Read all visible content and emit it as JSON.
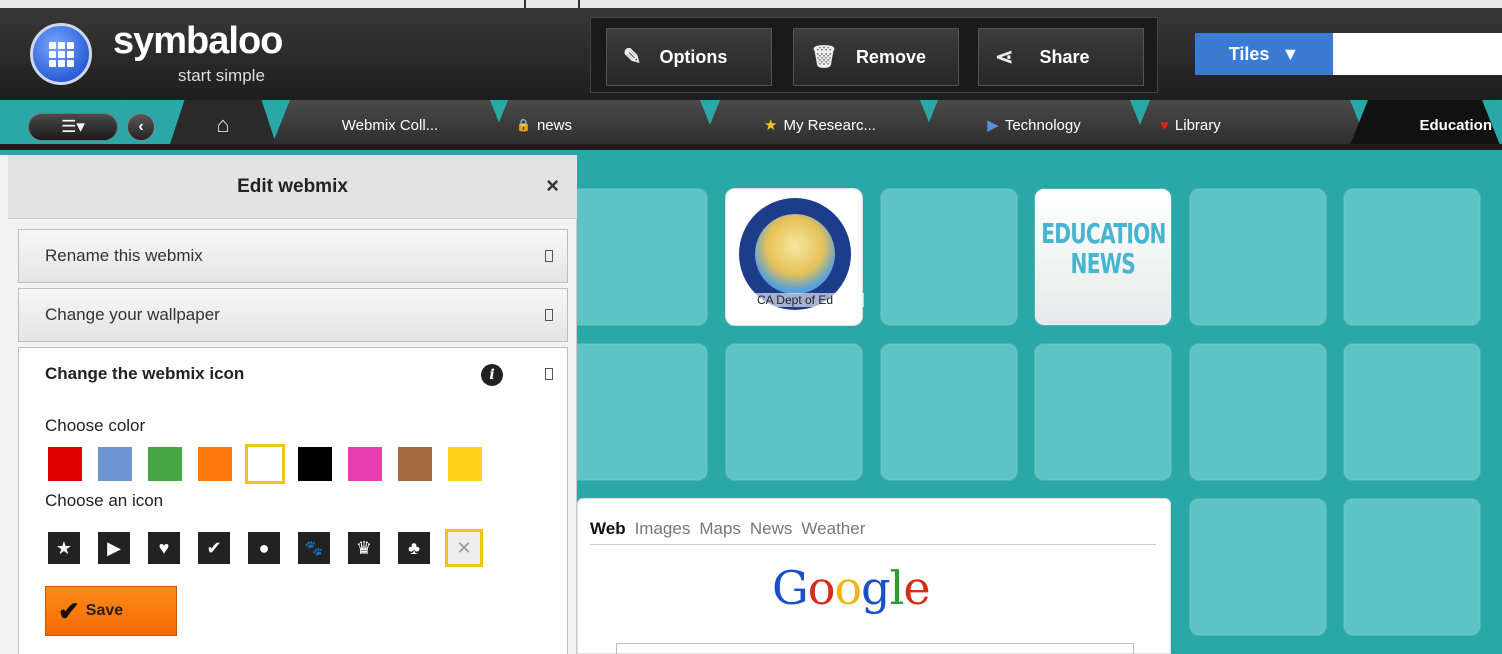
{
  "brand": {
    "name": "symbaloo",
    "tagline": "start simple"
  },
  "toolbar": {
    "options_label": "Options",
    "remove_label": "Remove",
    "share_label": "Share",
    "tiles_label": "Tiles",
    "tiles_arrow": "▼"
  },
  "tabs": {
    "menu_icon": "☰▾",
    "back_icon": "‹",
    "home_icon": "⌂",
    "items": [
      {
        "label": "Webmix Coll...",
        "icon": ""
      },
      {
        "label": "news",
        "icon": "🔒",
        "icon_name": "lock-icon"
      },
      {
        "label": "My Researc...",
        "icon": "★",
        "icon_name": "star-icon",
        "icon_color": "#f5c518"
      },
      {
        "label": "Technology",
        "icon": "▶",
        "icon_name": "play-icon",
        "icon_color": "#5a8fe0"
      },
      {
        "label": "Library",
        "icon": "♥",
        "icon_name": "heart-icon",
        "icon_color": "#e02020"
      },
      {
        "label": "Education",
        "icon": "",
        "active": true
      }
    ]
  },
  "panel": {
    "title": "Edit webmix",
    "close_icon": "×",
    "rename_label": "Rename this webmix",
    "wallpaper_label": "Change your wallpaper",
    "icon_section_title": "Change the webmix icon",
    "info_icon": "i",
    "choose_color_label": "Choose color",
    "choose_icon_label": "Choose an icon",
    "colors": [
      "#e00000",
      "#6e96d0",
      "#45a845",
      "#ff7a0d",
      "#ffffff",
      "#000000",
      "#e83fb0",
      "#a56a42",
      "#ffd21a"
    ],
    "selected_color_index": 4,
    "icons": [
      {
        "glyph": "★",
        "name": "star-icon"
      },
      {
        "glyph": "▶",
        "name": "play-icon"
      },
      {
        "glyph": "♥",
        "name": "heart-icon"
      },
      {
        "glyph": "✔",
        "name": "check-icon"
      },
      {
        "glyph": "●",
        "name": "dot-icon"
      },
      {
        "glyph": "🐾",
        "name": "paw-icon"
      },
      {
        "glyph": "♛",
        "name": "crown-icon"
      },
      {
        "glyph": "♣",
        "name": "club-icon"
      },
      {
        "glyph": "✕",
        "name": "no-icon"
      }
    ],
    "selected_icon_index": 8,
    "save_label": "Save"
  },
  "tiles": {
    "cadept_caption": "CA Dept of Ed",
    "edu_news_line1": "EDUCATION",
    "edu_news_line2": "NEWS"
  },
  "google_widget": {
    "tabs": [
      "Web",
      "Images",
      "Maps",
      "News",
      "Weather"
    ],
    "active_tab": "Web",
    "logo_letters": [
      {
        "ch": "G",
        "color": "#1a4fc8"
      },
      {
        "ch": "o",
        "color": "#d62c1a"
      },
      {
        "ch": "o",
        "color": "#f2b50f"
      },
      {
        "ch": "g",
        "color": "#1a4fc8"
      },
      {
        "ch": "l",
        "color": "#2f9a2f"
      },
      {
        "ch": "e",
        "color": "#d62c1a"
      }
    ]
  },
  "colors": {
    "accent_teal": "#2aa8a8",
    "tiles_blue": "#3c7bd4",
    "save_orange": "#f26a00",
    "selection_yellow": "#f0c419"
  }
}
